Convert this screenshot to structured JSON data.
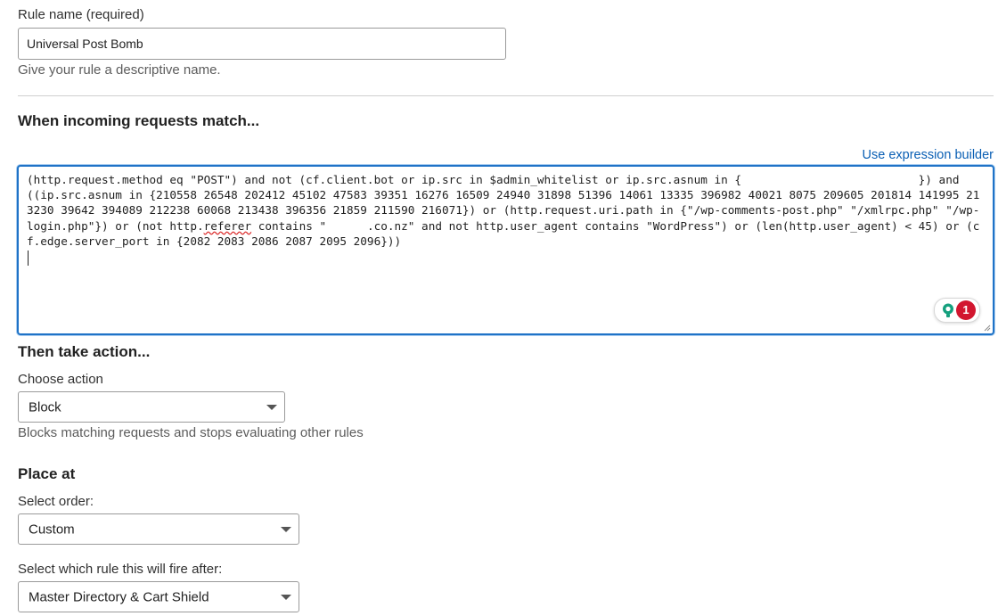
{
  "rule_name": {
    "label": "Rule name (required)",
    "value": "Universal Post Bomb",
    "help": "Give your rule a descriptive name."
  },
  "match": {
    "heading": "When incoming requests match...",
    "builder_link": "Use expression builder",
    "expression_parts": [
      "(http.request.method eq \"POST\") and not (cf.client.bot or ip.src in $admin_whitelist or ip.src.asnum in {                          }) and ((ip.src.asnum in {210558 26548 202412 45102 47583 39351 16276 16509 24940 31898 51396 14061 13335 396982 40021 8075 209605 201814 141995 213230 39642 394089 212238 60068 213438 396356 21859 211590 216071}) or (http.request.uri.path in {\"/wp-comments-post.php\" \"/xmlrpc.php\" \"/wp-login.php\"}) or (not http.",
      "referer",
      " contains \"      .co.nz\" and not http.user_agent contains \"WordPress\") or (len(http.user_agent) < 45) or (cf.edge.server_port in {2082 2083 2086 2087 2095 2096}))"
    ],
    "grammarly_count": "1"
  },
  "action": {
    "heading": "Then take action...",
    "choose_label": "Choose action",
    "selected": "Block",
    "help": "Blocks matching requests and stops evaluating other rules"
  },
  "place": {
    "heading": "Place at",
    "order_label": "Select order:",
    "order_selected": "Custom",
    "after_label": "Select which rule this will fire after:",
    "after_selected": "Master Directory & Cart Shield"
  }
}
